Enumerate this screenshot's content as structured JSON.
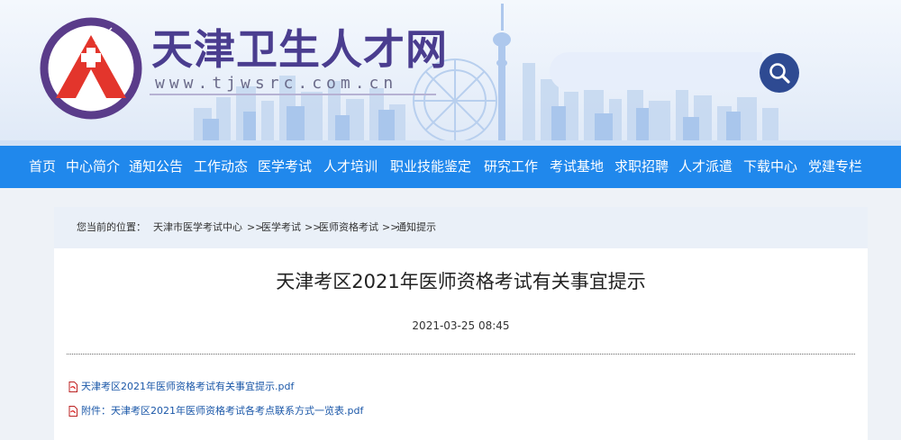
{
  "header": {
    "site_name": "天津卫生人才网",
    "site_url": "www.tjwsrc.com.cn",
    "logo_icon": "red-cross-house-logo-icon",
    "search": {
      "placeholder": "",
      "value": "",
      "icon": "search-icon"
    },
    "colors": {
      "brand_purple": "#4a3d8f",
      "logo_red": "#e3352c",
      "search_button": "#2e4a92"
    }
  },
  "nav": {
    "color": "#2088ec",
    "items": [
      {
        "label": "首页"
      },
      {
        "label": "中心简介"
      },
      {
        "label": "通知公告"
      },
      {
        "label": "工作动态"
      },
      {
        "label": "医学考试"
      },
      {
        "label": "人才培训"
      },
      {
        "label": "职业技能鉴定"
      },
      {
        "label": "研究工作"
      },
      {
        "label": "考试基地"
      },
      {
        "label": "求职招聘"
      },
      {
        "label": "人才派遣"
      },
      {
        "label": "下载中心"
      },
      {
        "label": "党建专栏"
      }
    ]
  },
  "breadcrumb": {
    "prefix": "您当前的位置：",
    "separator": ">>",
    "items": [
      {
        "label": "天津市医学考试中心"
      },
      {
        "label": "医学考试"
      },
      {
        "label": "医师资格考试"
      },
      {
        "label": "通知提示"
      }
    ]
  },
  "article": {
    "title": "天津考区2021年医师资格考试有关事宜提示",
    "date": "2021-03-25 08:45",
    "attachments": [
      {
        "label": "天津考区2021年医师资格考试有关事宜提示.pdf",
        "icon": "pdf-icon"
      },
      {
        "label": "附件：天津考区2021年医师资格考试各考点联系方式一览表.pdf",
        "icon": "pdf-icon"
      }
    ]
  }
}
